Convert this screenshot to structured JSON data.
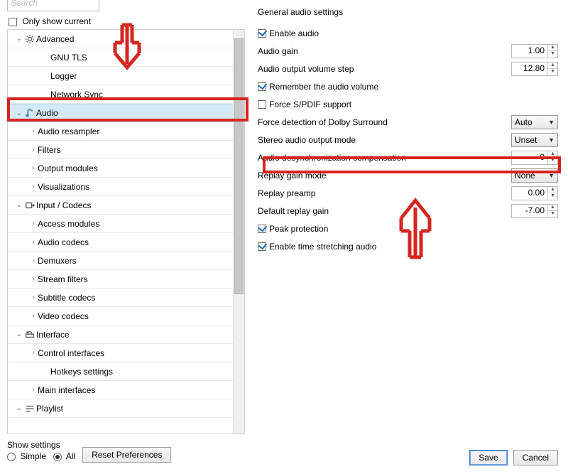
{
  "sidebar": {
    "search_placeholder": "Search",
    "only_show_current": "Only show current",
    "items": [
      {
        "label": "Advanced",
        "level": 0,
        "arrow": "v",
        "icon": "gear"
      },
      {
        "label": "GNU TLS",
        "level": 2,
        "arrow": ""
      },
      {
        "label": "Logger",
        "level": 2,
        "arrow": ""
      },
      {
        "label": "Network Sync",
        "level": 2,
        "arrow": ""
      },
      {
        "label": "Audio",
        "level": 0,
        "arrow": "v",
        "icon": "audio",
        "selected": true
      },
      {
        "label": "Audio resampler",
        "level": 1,
        "arrow": ">"
      },
      {
        "label": "Filters",
        "level": 1,
        "arrow": ">"
      },
      {
        "label": "Output modules",
        "level": 1,
        "arrow": ">"
      },
      {
        "label": "Visualizations",
        "level": 1,
        "arrow": ">"
      },
      {
        "label": "Input / Codecs",
        "level": 0,
        "arrow": "v",
        "icon": "input"
      },
      {
        "label": "Access modules",
        "level": 1,
        "arrow": ">"
      },
      {
        "label": "Audio codecs",
        "level": 1,
        "arrow": ">"
      },
      {
        "label": "Demuxers",
        "level": 1,
        "arrow": ">"
      },
      {
        "label": "Stream filters",
        "level": 1,
        "arrow": ">"
      },
      {
        "label": "Subtitle codecs",
        "level": 1,
        "arrow": ">"
      },
      {
        "label": "Video codecs",
        "level": 1,
        "arrow": ">"
      },
      {
        "label": "Interface",
        "level": 0,
        "arrow": "v",
        "icon": "interface"
      },
      {
        "label": "Control interfaces",
        "level": 1,
        "arrow": ">"
      },
      {
        "label": "Hotkeys settings",
        "level": 2,
        "arrow": ""
      },
      {
        "label": "Main interfaces",
        "level": 1,
        "arrow": ">"
      },
      {
        "label": "Playlist",
        "level": 0,
        "arrow": "v",
        "icon": "playlist"
      }
    ]
  },
  "settings": {
    "title": "General audio settings",
    "enable_audio": "Enable audio",
    "audio_gain_label": "Audio gain",
    "audio_gain_value": "1.00",
    "volume_step_label": "Audio output volume step",
    "volume_step_value": "12.80",
    "remember_volume": "Remember the audio volume",
    "force_spdif": "Force S/PDIF support",
    "dolby_label": "Force detection of Dolby Surround",
    "dolby_value": "Auto",
    "stereo_label": "Stereo audio output mode",
    "stereo_value": "Unset",
    "desync_label": "Audio desynchronization compensation",
    "desync_value": "0",
    "replay_mode_label": "Replay gain mode",
    "replay_mode_value": "None",
    "replay_preamp_label": "Replay preamp",
    "replay_preamp_value": "0.00",
    "default_gain_label": "Default replay gain",
    "default_gain_value": "-7.00",
    "peak_protection": "Peak protection",
    "time_stretching": "Enable time stretching audio"
  },
  "footer": {
    "show_settings": "Show settings",
    "simple": "Simple",
    "all": "All",
    "reset": "Reset Preferences",
    "save": "Save",
    "cancel": "Cancel"
  }
}
